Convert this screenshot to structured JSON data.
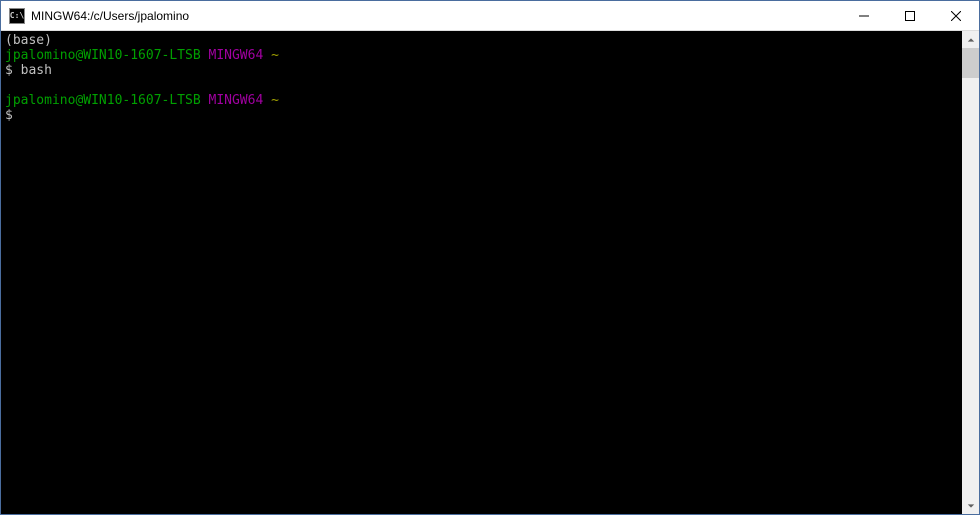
{
  "window": {
    "title": "MINGW64:/c/Users/jpalomino",
    "icon_label": "C:\\"
  },
  "terminal": {
    "lines": [
      {
        "segments": [
          {
            "cls": "clr-gray",
            "text": "(base)"
          }
        ]
      },
      {
        "segments": [
          {
            "cls": "clr-green",
            "text": "jpalomino@WIN10-1607-LTSB"
          },
          {
            "cls": "clr-gray",
            "text": " "
          },
          {
            "cls": "clr-magenta",
            "text": "MINGW64"
          },
          {
            "cls": "clr-gray",
            "text": " "
          },
          {
            "cls": "clr-yellow",
            "text": "~"
          }
        ]
      },
      {
        "segments": [
          {
            "cls": "clr-gray",
            "text": "$ bash"
          }
        ]
      },
      {
        "segments": [
          {
            "cls": "clr-gray",
            "text": ""
          }
        ]
      },
      {
        "segments": [
          {
            "cls": "clr-green",
            "text": "jpalomino@WIN10-1607-LTSB"
          },
          {
            "cls": "clr-gray",
            "text": " "
          },
          {
            "cls": "clr-magenta",
            "text": "MINGW64"
          },
          {
            "cls": "clr-gray",
            "text": " "
          },
          {
            "cls": "clr-yellow",
            "text": "~"
          }
        ]
      },
      {
        "segments": [
          {
            "cls": "clr-gray",
            "text": "$"
          }
        ]
      }
    ]
  }
}
